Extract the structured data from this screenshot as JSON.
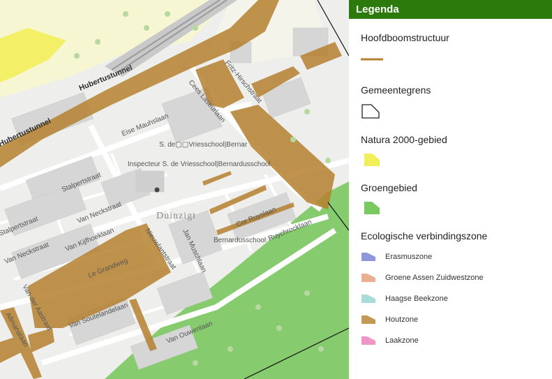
{
  "legend": {
    "title": "Legenda",
    "layers": [
      {
        "title": "Hoofdboomstructuur",
        "symbol": "line-swatch-icon",
        "color": "#b5812f"
      },
      {
        "title": "Gemeentegrens",
        "symbol": "polygon-outline-icon",
        "color": "#222222"
      },
      {
        "title": "Natura 2000-gebied",
        "symbol": "polygon-fill-icon",
        "color": "#f2ee5a"
      },
      {
        "title": "Groengebied",
        "symbol": "polygon-fill-icon",
        "color": "#7ac860"
      }
    ],
    "ecological": {
      "title": "Ecologische verbindingszone",
      "items": [
        {
          "label": "Erasmuszone",
          "color": "#8f97dc"
        },
        {
          "label": "Groene Assen Zuidwestzone",
          "color": "#eaae90"
        },
        {
          "label": "Haagse Beekzone",
          "color": "#a9dcd6"
        },
        {
          "label": "Houtzone",
          "color": "#c39a55"
        },
        {
          "label": "Laakzone",
          "color": "#ee96c6"
        }
      ]
    }
  },
  "map": {
    "labels": {
      "hubertustunnel_1": "Hubertustunnel",
      "hubertustunnel_2": "Hubertustunnel",
      "fritz_hirschstraat": "Fritz-Hirschstraat",
      "cees_laseurlaan": "Cees Laseurlaan",
      "eise_mauhslaan": "Eise Mauhslaan",
      "school_short": "S. de▢▢Vriesschool|Bernar",
      "school_full": "Inspecteur S. de Vriesschool|Bernardusschool",
      "stalpertstraat_1": "Stalpertstraat",
      "stalpertstraat_2": "Stalpertstraat",
      "van_neckstraat_1": "Van Neckstraat",
      "van_neckstraat_2": "Van Neckstraat",
      "van_kijfhoeklaan": "Van Kijfhoeklaan",
      "nieuwlantstraat": "Nieuwlantstraat",
      "jan_muschlaan": "Jan Muschlaan",
      "cor_ruyslaan": "Cor Ruyslaan",
      "bernardusschool": "Bernardusschool",
      "ruychrocklaan": "Ruychrocklaan",
      "duinzigt": "Duinzigt",
      "le_grandweg": "Le Grandweg",
      "van_der_aastraat": "Van der Aastraat",
      "van_soutelandelaan": "Van Soutelandelaan",
      "van_ouwenlaan": "Van Ouwenlaan",
      "allmanalaan": "Allmanalaan"
    }
  }
}
